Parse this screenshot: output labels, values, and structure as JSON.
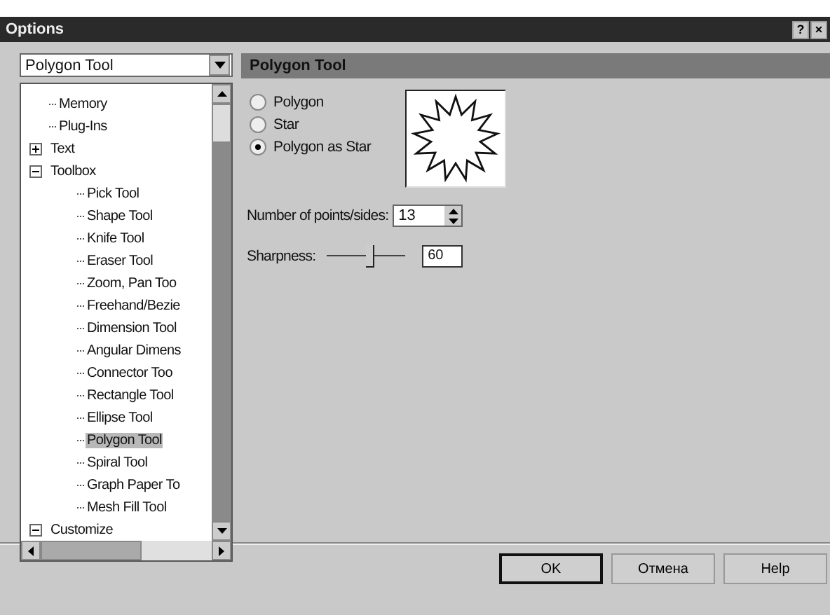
{
  "window": {
    "title": "Options",
    "buttons": [
      "?",
      "×"
    ]
  },
  "category_dropdown": {
    "value": "Polygon Tool"
  },
  "tree": [
    {
      "label": "Memory",
      "selected": false
    },
    {
      "label": "Plug-Ins",
      "selected": false
    },
    {
      "label": "Text",
      "selected": false,
      "expanded": false
    },
    {
      "label": "Toolbox",
      "selected": false,
      "expanded": true,
      "children": [
        {
          "label": "Pick Tool",
          "selected": false
        },
        {
          "label": "Shape Tool",
          "selected": false
        },
        {
          "label": "Knife Tool",
          "selected": false
        },
        {
          "label": "Eraser Tool",
          "selected": false
        },
        {
          "label": "Zoom, Pan Too",
          "selected": false
        },
        {
          "label": "Freehand/Bezie",
          "selected": false
        },
        {
          "label": "Dimension Tool",
          "selected": false
        },
        {
          "label": "Angular Dimens",
          "selected": false
        },
        {
          "label": "Connector Too",
          "selected": false
        },
        {
          "label": "Rectangle Tool",
          "selected": false
        },
        {
          "label": "Ellipse Tool",
          "selected": false
        },
        {
          "label": "Polygon Tool",
          "selected": true
        },
        {
          "label": "Spiral Tool",
          "selected": false
        },
        {
          "label": "Graph Paper To",
          "selected": false
        },
        {
          "label": "Mesh Fill Tool",
          "selected": false
        }
      ]
    },
    {
      "label": "Customize",
      "selected": false,
      "expanded": true
    }
  ],
  "panel": {
    "title": "Polygon Tool",
    "shape_options": [
      {
        "label": "Polygon",
        "selected": false
      },
      {
        "label": "Star",
        "selected": false
      },
      {
        "label": "Polygon as Star",
        "selected": true
      }
    ],
    "points": {
      "label": "Number of points/sides:",
      "value": "13"
    },
    "sharpness": {
      "label": "Sharpness:",
      "level": 0.55,
      "value": "60"
    }
  },
  "buttons": [
    {
      "label": "OK",
      "default": true
    },
    {
      "label": "Отмена",
      "default": false
    },
    {
      "label": "Help",
      "default": false
    }
  ]
}
